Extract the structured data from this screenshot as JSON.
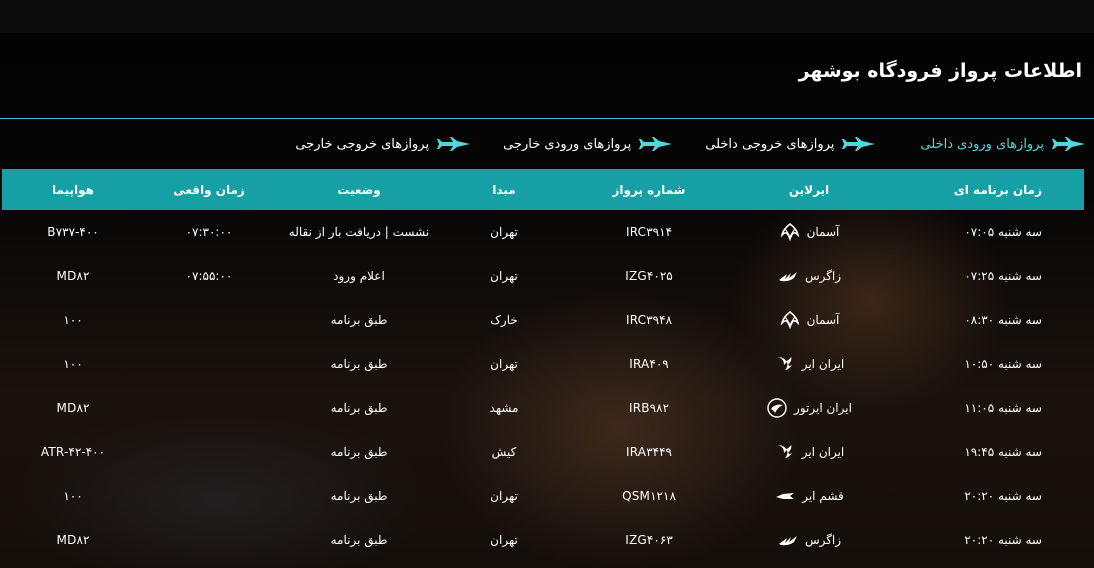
{
  "page": {
    "title": "اطلاعات پرواز فرودگاه بوشهر"
  },
  "tabs": [
    {
      "label": "پروازهای ورودی داخلی",
      "active": true,
      "icon": "plane-landing-icon"
    },
    {
      "label": "پروازهای خروجی داخلی",
      "active": false,
      "icon": "plane-takeoff-icon"
    },
    {
      "label": "پروازهای ورودی خارجی",
      "active": false,
      "icon": "plane-landing-icon"
    },
    {
      "label": "پروازهای خروجی خارجی",
      "active": false,
      "icon": "plane-takeoff-icon"
    }
  ],
  "table": {
    "headers": [
      "زمان برنامه ای",
      "ایرلاین",
      "شماره پرواز",
      "مبدا",
      "وضعیت",
      "زمان واقعی",
      "هواپیما"
    ],
    "rows": [
      {
        "time": "سه شنبه ۰۷:۰۵",
        "airline": "آسمان",
        "logo": "aseman-logo-icon",
        "flight": "IRC۳۹۱۴",
        "origin": "تهران",
        "status": "نشست | دریافت بار از نقاله",
        "actual": "۰۷:۳۰:۰۰",
        "aircraft": "B۷۳۷-۴۰۰"
      },
      {
        "time": "سه شنبه ۰۷:۲۵",
        "airline": "زاگرس",
        "logo": "zagros-logo-icon",
        "flight": "IZG۴۰۲۵",
        "origin": "تهران",
        "status": "اعلام ورود",
        "actual": "۰۷:۵۵:۰۰",
        "aircraft": "MD۸۲"
      },
      {
        "time": "سه شنبه ۰۸:۳۰",
        "airline": "آسمان",
        "logo": "aseman-logo-icon",
        "flight": "IRC۳۹۴۸",
        "origin": "خارک",
        "status": "طبق برنامه",
        "actual": "",
        "aircraft": "۱۰۰"
      },
      {
        "time": "سه شنبه ۱۰:۵۰",
        "airline": "ایران ایر",
        "logo": "iranair-logo-icon",
        "flight": "IRA۴۰۹",
        "origin": "تهران",
        "status": "طبق برنامه",
        "actual": "",
        "aircraft": "۱۰۰"
      },
      {
        "time": "سه شنبه ۱۱:۰۵",
        "airline": "ایران ایرتور",
        "logo": "iranairtour-logo-icon",
        "flight": "IRB۹۸۲",
        "origin": "مشهد",
        "status": "طبق برنامه",
        "actual": "",
        "aircraft": "MD۸۲"
      },
      {
        "time": "سه شنبه ۱۹:۴۵",
        "airline": "ایران ایر",
        "logo": "iranair-logo-icon",
        "flight": "IRA۳۴۴۹",
        "origin": "کیش",
        "status": "طبق برنامه",
        "actual": "",
        "aircraft": "ATR-۴۲-۴۰۰"
      },
      {
        "time": "سه شنبه ۲۰:۲۰",
        "airline": "قشم ایر",
        "logo": "qeshmair-logo-icon",
        "flight": "QSM۱۲۱۸",
        "origin": "تهران",
        "status": "طبق برنامه",
        "actual": "",
        "aircraft": "۱۰۰"
      },
      {
        "time": "سه شنبه ۲۰:۲۰",
        "airline": "زاگرس",
        "logo": "zagros-logo-icon",
        "flight": "IZG۴۰۶۳",
        "origin": "تهران",
        "status": "طبق برنامه",
        "actual": "",
        "aircraft": "MD۸۲"
      }
    ]
  },
  "colors": {
    "accent": "#16a0a6",
    "active_tab": "#52d8db",
    "divider": "#2ec2c6"
  }
}
